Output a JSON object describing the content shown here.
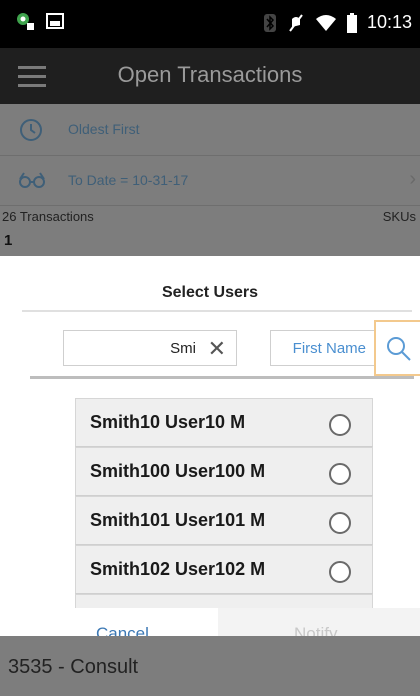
{
  "status_bar": {
    "time": "10:13",
    "icons": [
      "app-notification-icon",
      "image-icon",
      "bluetooth-icon",
      "mute-icon",
      "wifi-icon",
      "battery-icon"
    ]
  },
  "app_bar": {
    "title": "Open Transactions",
    "menu_icon": "menu-icon"
  },
  "background": {
    "sort_label": "Oldest First",
    "date_filter_label": "To Date = 10-31-17",
    "count_label": "26 Transactions",
    "skus_label": "SKUs",
    "first_item": "1",
    "bottom_text": "3535 - Consult"
  },
  "dialog": {
    "title": "Select Users",
    "search_value": "Smi",
    "field_select": "First Name",
    "users": [
      {
        "name": "Smith10 User10 M"
      },
      {
        "name": "Smith100 User100 M"
      },
      {
        "name": "Smith101 User101 M"
      },
      {
        "name": "Smith102 User102 M"
      }
    ],
    "cancel_label": "Cancel",
    "notify_label": "Notify"
  },
  "colors": {
    "accent": "#3c78b4",
    "search_highlight": "#f3c98d"
  }
}
